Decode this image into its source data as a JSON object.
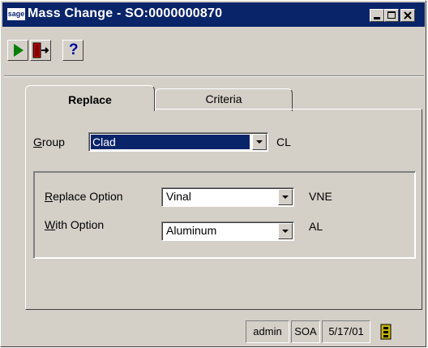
{
  "window": {
    "logo_text": "sage",
    "title": "Mass Change - SO:0000000870"
  },
  "toolbar": {
    "run_icon": "green-play-icon",
    "exit_icon": "exit-door-icon",
    "help_label": "?"
  },
  "tabs": [
    {
      "label": "Replace",
      "active": true
    },
    {
      "label": "Criteria",
      "active": false
    }
  ],
  "group": {
    "label": "Group",
    "mnemonic": "G",
    "value": "Clad",
    "code": "CL"
  },
  "replace_option": {
    "label": "Replace Option",
    "mnemonic": "R",
    "value": "Vinal",
    "code": "VNE"
  },
  "with_option": {
    "label": "With Option",
    "mnemonic": "W",
    "value": "Aluminum",
    "code": "AL"
  },
  "status_bar": {
    "user": "admin",
    "company": "SOA",
    "date": "5/17/01",
    "icon": "module-icon"
  },
  "colors": {
    "titlebar": "#0a246a",
    "face": "#d4d0c8",
    "highlight": "#0a246a"
  }
}
